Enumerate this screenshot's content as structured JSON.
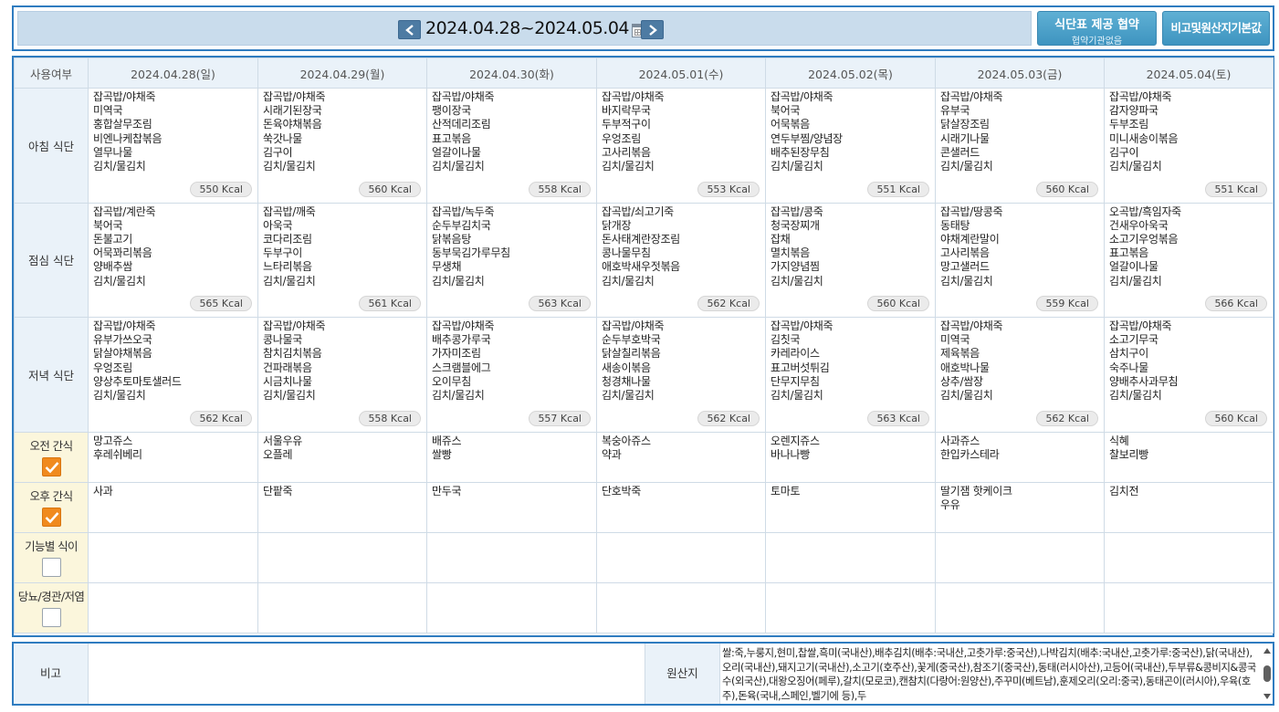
{
  "header": {
    "date_range": "2024.04.28~2024.05.04",
    "contract_button": "식단표 제공 협약",
    "contract_status": "협약기관없음",
    "origin_default_button": "비고및원산지기본값"
  },
  "table": {
    "usage_header": "사용여부",
    "days": [
      {
        "label": "2024.04.28(일)",
        "kind": "sun"
      },
      {
        "label": "2024.04.29(월)",
        "kind": "wd"
      },
      {
        "label": "2024.04.30(화)",
        "kind": "wd"
      },
      {
        "label": "2024.05.01(수)",
        "kind": "wd"
      },
      {
        "label": "2024.05.02(목)",
        "kind": "wd"
      },
      {
        "label": "2024.05.03(금)",
        "kind": "wd"
      },
      {
        "label": "2024.05.04(토)",
        "kind": "sat"
      }
    ],
    "meals": [
      {
        "label": "아침 식단",
        "cells": [
          {
            "items": [
              "잡곡밥/야채죽",
              "미역국",
              "홍합살무조림",
              "비엔나케찹볶음",
              "열무나물",
              "김치/물김치"
            ],
            "kcal": "550 Kcal"
          },
          {
            "items": [
              "잡곡밥/야채죽",
              "시래기된장국",
              "돈육야채볶음",
              "쑥갓나물",
              "김구이",
              "김치/물김치"
            ],
            "kcal": "560 Kcal"
          },
          {
            "items": [
              "잡곡밥/야채죽",
              "팽이장국",
              "산적데리조림",
              "표고볶음",
              "얼갈이나물",
              "김치/물김치"
            ],
            "kcal": "558 Kcal"
          },
          {
            "items": [
              "잡곡밥/야채죽",
              "바지락무국",
              "두부적구이",
              "우엉조림",
              "고사리볶음",
              "김치/물김치"
            ],
            "kcal": "553 Kcal"
          },
          {
            "items": [
              "잡곡밥/야채죽",
              "북어국",
              "어묵볶음",
              "연두부찜/양념장",
              "배추된장무침",
              "김치/물김치"
            ],
            "kcal": "551 Kcal"
          },
          {
            "items": [
              "잡곡밥/야채죽",
              "유부국",
              "닭살장조림",
              "시래기나물",
              "콘샐러드",
              "김치/물김치"
            ],
            "kcal": "560 Kcal"
          },
          {
            "items": [
              "잡곡밥/야채죽",
              "감자양파국",
              "두부조림",
              "미니새송이볶음",
              "김구이",
              "김치/물김치"
            ],
            "kcal": "551 Kcal"
          }
        ]
      },
      {
        "label": "점심 식단",
        "cells": [
          {
            "items": [
              "잡곡밥/계란죽",
              "북어국",
              "돈불고기",
              "어묵꽈리볶음",
              "양배추쌈",
              "김치/물김치"
            ],
            "kcal": "565 Kcal"
          },
          {
            "items": [
              "잡곡밥/깨죽",
              "아욱국",
              "코다리조림",
              "두부구이",
              "느타리볶음",
              "김치/물김치"
            ],
            "kcal": "561 Kcal"
          },
          {
            "items": [
              "잡곡밥/녹두죽",
              "순두부김치국",
              "닭볶음탕",
              "동부묵김가루무침",
              "무생채",
              "김치/물김치"
            ],
            "kcal": "563 Kcal"
          },
          {
            "items": [
              "잡곡밥/쇠고기죽",
              "닭개장",
              "돈사태계란장조림",
              "콩나물무침",
              "애호박새우젓볶음",
              "김치/물김치"
            ],
            "kcal": "562 Kcal"
          },
          {
            "items": [
              "잡곡밥/콩죽",
              "청국장찌개",
              "잡채",
              "멸치볶음",
              "가지양념찜",
              "김치/물김치"
            ],
            "kcal": "560 Kcal"
          },
          {
            "items": [
              "잡곡밥/땅콩죽",
              "동태탕",
              "야채계란말이",
              "고사리볶음",
              "망고샐러드",
              "김치/물김치"
            ],
            "kcal": "559 Kcal"
          },
          {
            "items": [
              "오곡밥/흑임자죽",
              "건새우아욱국",
              "소고기우엉볶음",
              "표고볶음",
              "얼갈이나물",
              "김치/물김치"
            ],
            "kcal": "566 Kcal"
          }
        ]
      },
      {
        "label": "저녁 식단",
        "cells": [
          {
            "items": [
              "잡곡밥/야채죽",
              "유부가쓰오국",
              "닭살야채볶음",
              "우엉조림",
              "양상추토마토샐러드",
              "김치/물김치"
            ],
            "kcal": "562 Kcal"
          },
          {
            "items": [
              "잡곡밥/야채죽",
              "콩나물국",
              "참치김치볶음",
              "건파래볶음",
              "시금치나물",
              "김치/물김치"
            ],
            "kcal": "558 Kcal"
          },
          {
            "items": [
              "잡곡밥/야채죽",
              "배추콩가루국",
              "가자미조림",
              "스크램블에그",
              "오이무침",
              "김치/물김치"
            ],
            "kcal": "557 Kcal"
          },
          {
            "items": [
              "잡곡밥/야채죽",
              "순두부호박국",
              "닭살칠리볶음",
              "새송이볶음",
              "청경채나물",
              "김치/물김치"
            ],
            "kcal": "562 Kcal"
          },
          {
            "items": [
              "잡곡밥/야채죽",
              "김칫국",
              "카레라이스",
              "표고버섯튀김",
              "단무지무침",
              "김치/물김치"
            ],
            "kcal": "563 Kcal"
          },
          {
            "items": [
              "잡곡밥/야채죽",
              "미역국",
              "제육볶음",
              "애호박나물",
              "상추/쌈장",
              "김치/물김치"
            ],
            "kcal": "562 Kcal"
          },
          {
            "items": [
              "잡곡밥/야채죽",
              "소고기무국",
              "삼치구이",
              "숙주나물",
              "양배추사과무침",
              "김치/물김치"
            ],
            "kcal": "560 Kcal"
          }
        ]
      }
    ],
    "snacks": [
      {
        "label": "오전 간식",
        "checked": true,
        "cells": [
          [
            "망고쥬스",
            "후레쉬베리"
          ],
          [
            "서울우유",
            "오플레"
          ],
          [
            "배쥬스",
            "쌀빵"
          ],
          [
            "복숭아쥬스",
            "약과"
          ],
          [
            "오렌지쥬스",
            "바나나빵"
          ],
          [
            "사과쥬스",
            "한입카스테라"
          ],
          [
            "식혜",
            "찰보리빵"
          ]
        ]
      },
      {
        "label": "오후 간식",
        "checked": true,
        "cells": [
          [
            "사과"
          ],
          [
            "단팥죽"
          ],
          [
            "만두국"
          ],
          [
            "단호박죽"
          ],
          [
            "토마토"
          ],
          [
            "딸기잼 핫케이크",
            "우유"
          ],
          [
            "김치전"
          ]
        ]
      },
      {
        "label": "기능별 식이",
        "checked": false,
        "cells": [
          [],
          [],
          [],
          [],
          [],
          [],
          []
        ]
      },
      {
        "label": "당뇨/경관/저염",
        "checked": false,
        "cells": [
          [],
          [],
          [],
          [],
          [],
          [],
          []
        ]
      }
    ]
  },
  "remarks": {
    "remark_label": "비고",
    "remark_value": "",
    "origin_label": "원산지",
    "origin_text": "쌀:죽,누룽지,현미,찹쌀,흑미(국내산),배추김치(배추:국내산,고춧가루:중국산),나박김치(배추:국내산,고춧가루:중국산),닭(국내산),오리(국내산),돼지고기(국내산),소고기(호주산),꽃게(중국산),참조기(중국산),동태(러시아산),고등어(국내산),두부류&콩비지&콩국수(외국산),대왕오징어(페루),갈치(모로코),캔참치(다랑어:원양산),주꾸미(베트남),훈제오리(오리:중국),동태곤이(러시아),우육(호주),돈육(국내,스페인,벨기에 등),두"
  },
  "colors": {
    "border_blue": "#2f7cc0",
    "header_bg": "#eaf2f9",
    "snack_label_bg": "#fbf6dc",
    "button_blue": "#3e94c0",
    "checkbox_orange": "#f08a1e",
    "sunday_red": "#d0202e",
    "saturday_blue": "#2347b5"
  },
  "icons": {
    "prev": "chevron-left-icon",
    "next": "chevron-right-icon",
    "calendar": "calendar-icon"
  }
}
